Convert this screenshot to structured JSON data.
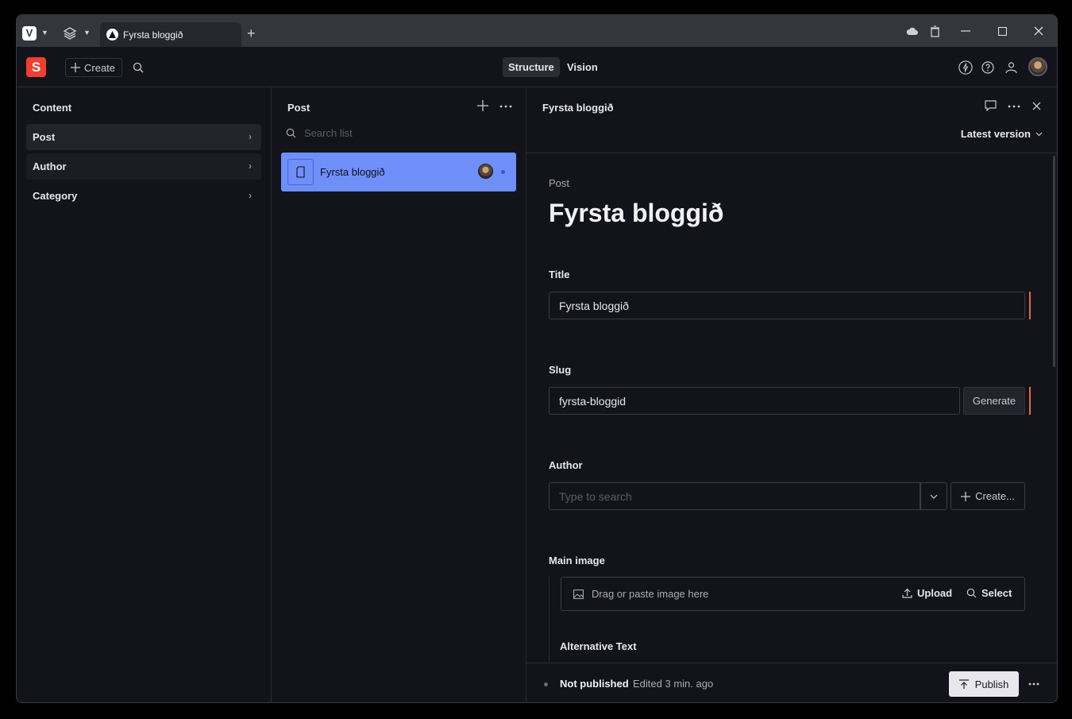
{
  "browser": {
    "tab_title": "Fyrsta bloggið"
  },
  "header": {
    "create_label": "Create",
    "nav_tabs": [
      "Structure",
      "Vision"
    ]
  },
  "content_pane": {
    "title": "Content",
    "items": [
      {
        "label": "Post"
      },
      {
        "label": "Author"
      },
      {
        "label": "Category"
      }
    ]
  },
  "list_pane": {
    "title": "Post",
    "search_placeholder": "Search list",
    "documents": [
      {
        "label": "Fyrsta bloggið"
      }
    ]
  },
  "doc_pane": {
    "header_title": "Fyrsta bloggið",
    "version_label": "Latest version",
    "doc_type": "Post",
    "doc_title": "Fyrsta bloggið",
    "fields": {
      "title_label": "Title",
      "title_value": "Fyrsta bloggið",
      "slug_label": "Slug",
      "slug_value": "fyrsta-bloggid",
      "generate_label": "Generate",
      "author_label": "Author",
      "author_placeholder": "Type to search",
      "author_create_label": "Create...",
      "main_image_label": "Main image",
      "image_drop_text": "Drag or paste image here",
      "upload_label": "Upload",
      "select_label": "Select",
      "alt_text_label": "Alternative Text"
    },
    "footer": {
      "status": "Not published",
      "edited": "Edited 3 min. ago",
      "publish_label": "Publish"
    }
  },
  "colors": {
    "accent_brand": "#f03e2f",
    "selected_row": "#6f8ff9",
    "change_indicator": "#e56b3f"
  }
}
